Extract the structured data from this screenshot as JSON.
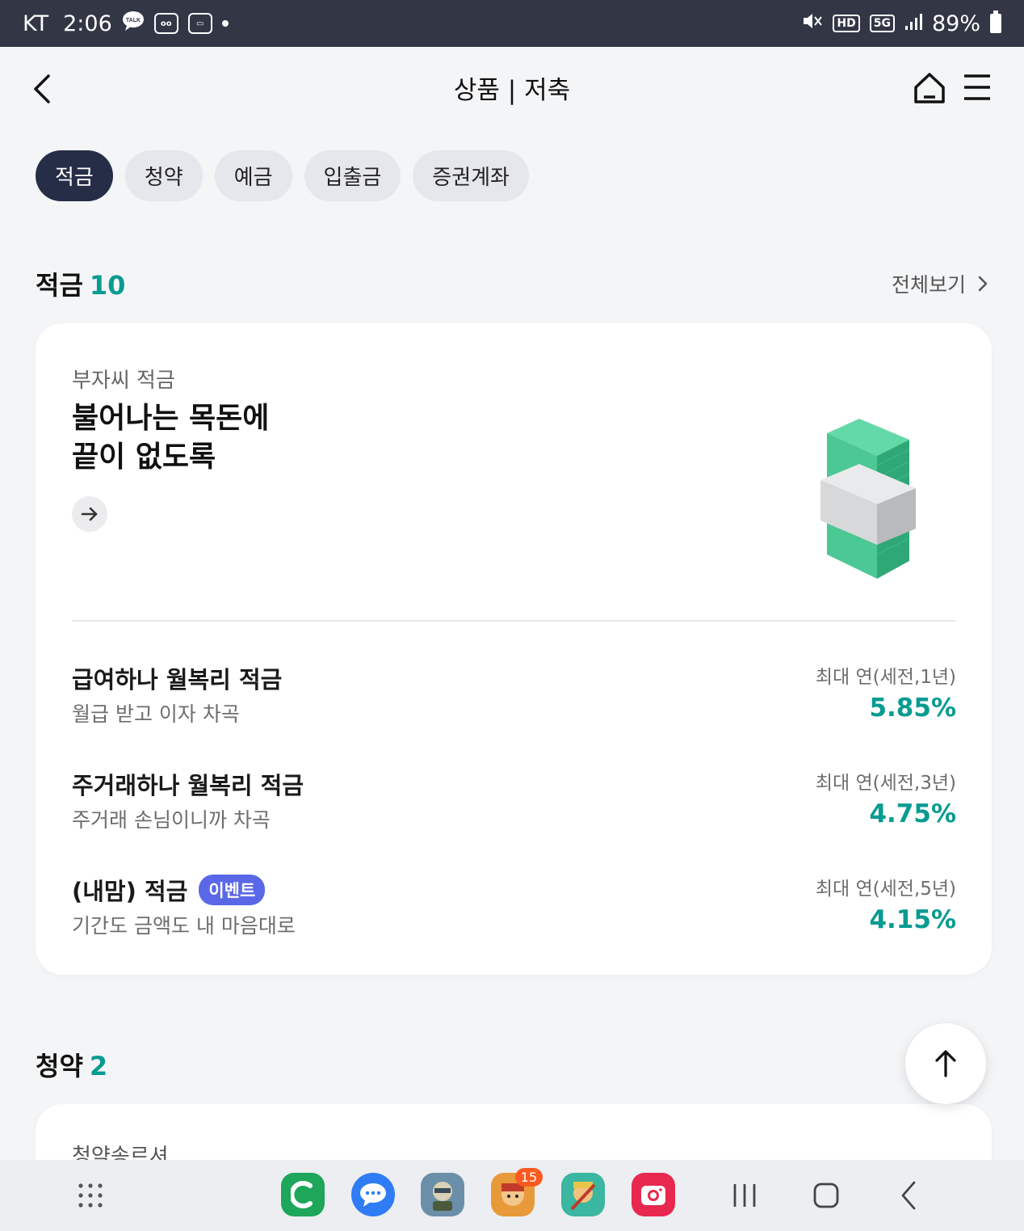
{
  "status_bar": {
    "carrier": "KT",
    "time": "2:06",
    "notif_icons": [
      "talk-icon",
      "voicemail-icon",
      "card-icon"
    ],
    "sys_icons": [
      "mute-icon",
      "hd-icon",
      "5g-icon",
      "signal-icon"
    ],
    "hd_label": "HD",
    "net_label": "5G",
    "battery": "89%"
  },
  "header": {
    "title": "상품 | 저축"
  },
  "chips": [
    {
      "label": "적금",
      "active": true
    },
    {
      "label": "청약",
      "active": false
    },
    {
      "label": "예금",
      "active": false
    },
    {
      "label": "입출금",
      "active": false
    },
    {
      "label": "증권계좌",
      "active": false
    }
  ],
  "savings_section": {
    "title": "적금",
    "count": "10",
    "view_all": "전체보기",
    "promo": {
      "subtitle": "부자씨 적금",
      "headline": "불어나는 목돈에\n끝이 없도록"
    },
    "products": [
      {
        "name": "급여하나 월복리 적금",
        "desc": "월급 받고 이자 차곡",
        "rate_label": "최대 연(세전,1년)",
        "rate": "5.85%",
        "badge": ""
      },
      {
        "name": "주거래하나 월복리 적금",
        "desc": "주거래 손님이니까 차곡",
        "rate_label": "최대 연(세전,3년)",
        "rate": "4.75%",
        "badge": ""
      },
      {
        "name": "(내맘) 적금",
        "desc": "기간도 금액도 내 마음대로",
        "rate_label": "최대 연(세전,5년)",
        "rate": "4.15%",
        "badge": "이벤트"
      }
    ]
  },
  "subscription_section": {
    "title": "청약",
    "count": "2",
    "preview": "청약송르셔"
  },
  "colors": {
    "accent": "#079b91",
    "chip_active": "#252d47",
    "badge": "#5a68e8",
    "status_bar": "#323645"
  },
  "nav": {
    "apps": [
      {
        "name": "phone-app-icon",
        "color": "#1ea65a",
        "badge": ""
      },
      {
        "name": "messages-app-icon",
        "color": "#2f7cf6",
        "badge": ""
      },
      {
        "name": "game-app-icon-1",
        "color": "#6b8fa8",
        "badge": ""
      },
      {
        "name": "game-app-icon-2",
        "color": "#e89a3a",
        "badge": "15"
      },
      {
        "name": "game-app-icon-3",
        "color": "#3bb6a0",
        "badge": ""
      },
      {
        "name": "camera-app-icon",
        "color": "#e8284f",
        "badge": ""
      }
    ]
  }
}
